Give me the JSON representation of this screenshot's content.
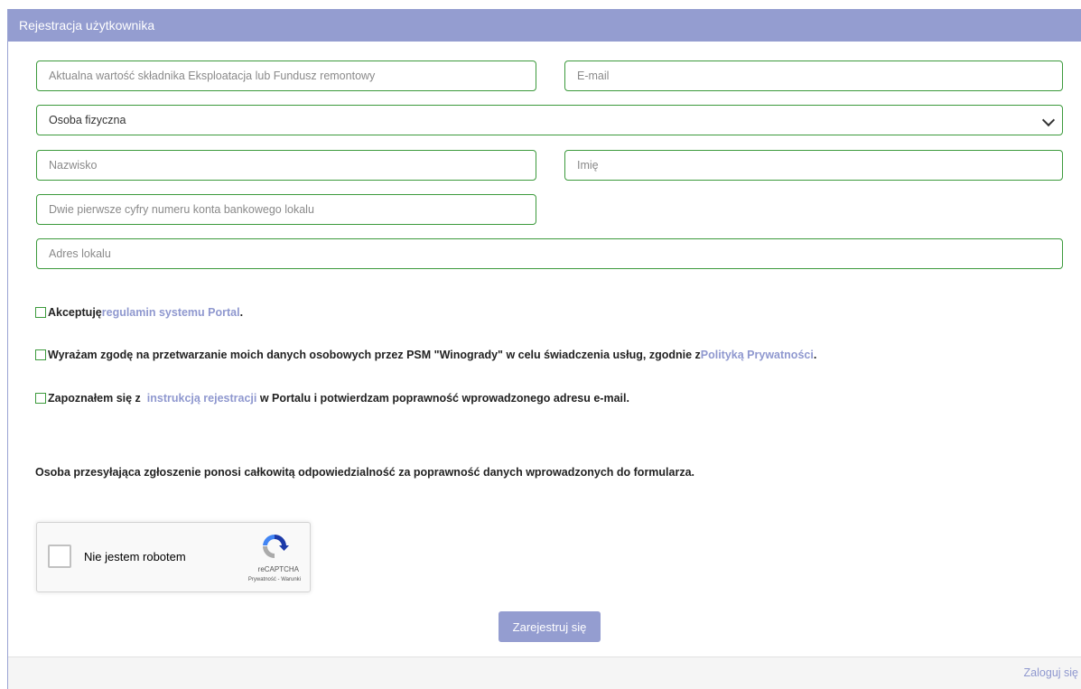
{
  "header": {
    "title": "Rejestracja użytkownika"
  },
  "form": {
    "fund_value_placeholder": "Aktualna wartość składnika Eksploatacja lub Fundusz remontowy",
    "email_placeholder": "E-mail",
    "person_type_selected": "Osoba fizyczna",
    "surname_placeholder": "Nazwisko",
    "name_placeholder": "Imię",
    "bank_digits_placeholder": "Dwie pierwsze cyfry numeru konta bankowego lokalu",
    "address_placeholder": "Adres lokalu"
  },
  "consents": [
    {
      "before": "Akceptuję ",
      "link": "regulamin systemu Portal",
      "after": "."
    },
    {
      "before": "Wyrażam zgodę na przetwarzanie moich danych osobowych przez PSM \"Winogrady\" w celu świadczenia usług, zgodnie z ",
      "link": "Polityką Prywatności",
      "after": "."
    },
    {
      "before": "Zapoznałem się z  ",
      "link": "instrukcją rejestracji",
      "after": " w Portalu i potwierdzam poprawność wprowadzonego adresu e-mail."
    }
  ],
  "notice": "Osoba przesyłająca zgłoszenie ponosi całkowitą odpowiedzialność za poprawność danych wprowadzonych do formularza.",
  "recaptcha": {
    "label": "Nie jestem robotem",
    "brand": "reCAPTCHA",
    "terms": "Prywatność - Warunki"
  },
  "submit_label": "Zarejestruj się",
  "footer": {
    "login_label": "Zaloguj się"
  },
  "colors": {
    "accent": "#949dd0",
    "field_border": "#3c9a3c",
    "link": "#8f98cf"
  }
}
